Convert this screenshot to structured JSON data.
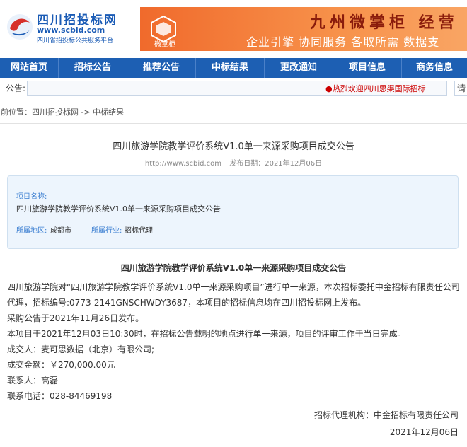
{
  "header": {
    "logo_title": "四川招投标网",
    "logo_url": "www.scbid.com",
    "logo_subtitle": "四川省招投标公共服务平台",
    "banner_brand": "微掌柜",
    "banner_title": "九州微掌柜  经营",
    "banner_tagline": "企业引擎 协同服务 各取所需  数据支"
  },
  "nav": {
    "items": [
      "网站首页",
      "招标公告",
      "推荐公告",
      "中标结果",
      "更改通知",
      "项目信息",
      "商务信息"
    ]
  },
  "notice": {
    "label": "公告:",
    "scroll_text": "●热烈欢迎四川思渠国际招标",
    "button_label": "请"
  },
  "breadcrumb": {
    "text": "当前位置：四川招投标网 -> 中标结果"
  },
  "article": {
    "title": "四川旅游学院教学评价系统V1.0单一来源采购项目成交公告",
    "source_url": "http://www.scbid.com",
    "publish_date": "发布日期：2021年12月06日"
  },
  "info": {
    "project_label": "项目名称:",
    "project_name": "四川旅游学院教学评价系统V1.0单一来源采购项目成交公告",
    "region_label": "所属地区:",
    "region_value": "成都市",
    "industry_label": "所属行业:",
    "industry_value": "招标代理"
  },
  "content": {
    "heading": "四川旅游学院教学评价系统V1.0单一来源采购项目成交公告",
    "para1": "四川旅游学院对“四川旅游学院教学评价系统V1.0单一来源采购项目”进行单一来源，本次招标委托中金招标有限责任公司代理，招标编号:0773-2141GNSCHWDY3687，本项目的招标信息均在四川招投标网上发布。",
    "line_announce": "采购公告于2021年11月26日发布。",
    "line_schedule": "本项目于2021年12月03日10:30时，在招标公告载明的地点进行单一来源，项目的评审工作于当日完成。",
    "line_winner": "成交人：麦可思数据（北京）有限公司;",
    "line_amount": "成交金额：￥270,000.00元",
    "line_contact": "联系人：高磊",
    "line_phone": "联系电话：028-84469198",
    "agency": "招标代理机构：中金招标有限责任公司",
    "date": "2021年12月06日"
  },
  "colors": {
    "nav_bg": "#1d5fb3",
    "accent_blue": "#3a7ed1",
    "banner_orange": "#f06a2c",
    "info_bg": "#edf5fd"
  }
}
